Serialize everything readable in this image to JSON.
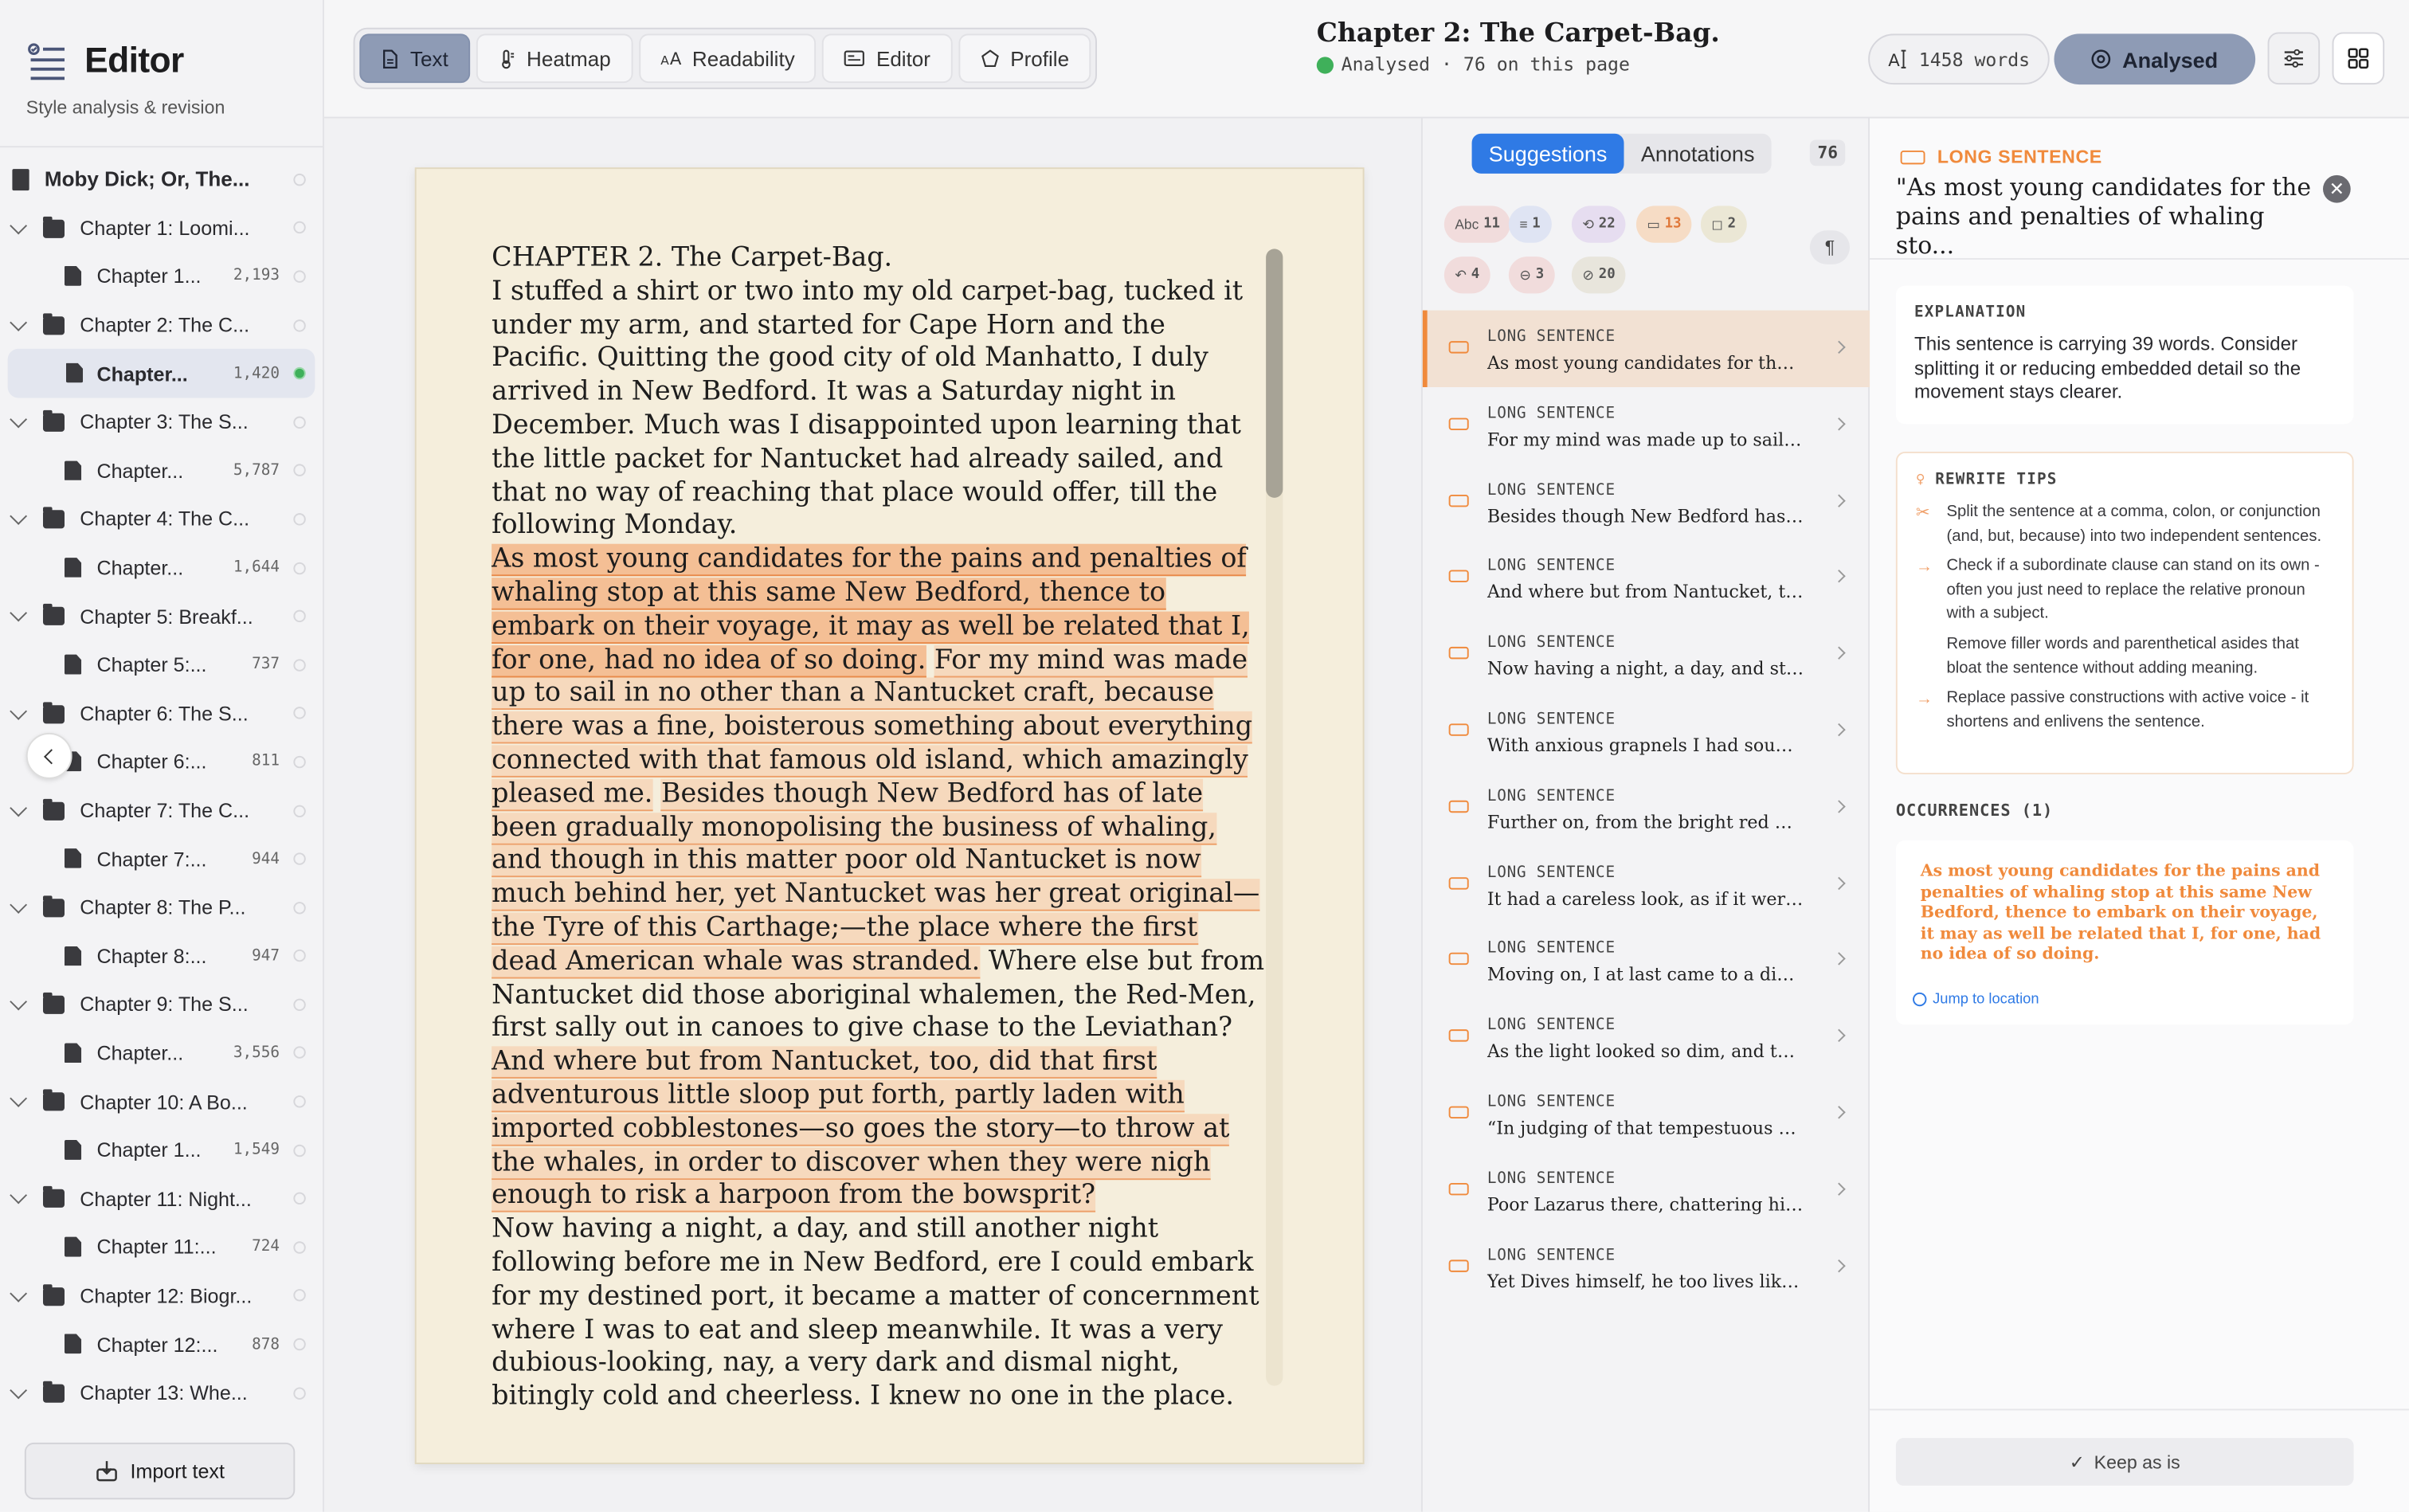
{
  "brand": {
    "title": "Editor",
    "subtitle": "Style analysis & revision"
  },
  "tree": [
    {
      "type": "root",
      "label": "Moby Dick; Or, The..."
    },
    {
      "type": "folder",
      "label": "Chapter 1: Loomi..."
    },
    {
      "type": "doc",
      "label": "Chapter 1...",
      "count": "2,193"
    },
    {
      "type": "folder",
      "label": "Chapter 2: The C..."
    },
    {
      "type": "doc",
      "label": "Chapter...",
      "count": "1,420",
      "selected": true
    },
    {
      "type": "folder",
      "label": "Chapter 3: The S..."
    },
    {
      "type": "doc",
      "label": "Chapter...",
      "count": "5,787"
    },
    {
      "type": "folder",
      "label": "Chapter 4: The C..."
    },
    {
      "type": "doc",
      "label": "Chapter...",
      "count": "1,644"
    },
    {
      "type": "folder",
      "label": "Chapter 5: Breakf..."
    },
    {
      "type": "doc",
      "label": "Chapter 5:...",
      "count": "737"
    },
    {
      "type": "folder",
      "label": "Chapter 6: The S..."
    },
    {
      "type": "doc",
      "label": "Chapter 6:...",
      "count": "811"
    },
    {
      "type": "folder",
      "label": "Chapter 7: The C..."
    },
    {
      "type": "doc",
      "label": "Chapter 7:...",
      "count": "944"
    },
    {
      "type": "folder",
      "label": "Chapter 8: The P..."
    },
    {
      "type": "doc",
      "label": "Chapter 8:...",
      "count": "947"
    },
    {
      "type": "folder",
      "label": "Chapter 9: The S..."
    },
    {
      "type": "doc",
      "label": "Chapter...",
      "count": "3,556"
    },
    {
      "type": "folder",
      "label": "Chapter 10: A Bo..."
    },
    {
      "type": "doc",
      "label": "Chapter 1...",
      "count": "1,549"
    },
    {
      "type": "folder",
      "label": "Chapter 11: Night..."
    },
    {
      "type": "doc",
      "label": "Chapter 11:...",
      "count": "724"
    },
    {
      "type": "folder",
      "label": "Chapter 12: Biogr..."
    },
    {
      "type": "doc",
      "label": "Chapter 12:...",
      "count": "878"
    },
    {
      "type": "folder",
      "label": "Chapter 13: Whe..."
    }
  ],
  "import_label": "Import text",
  "modes": [
    "Text",
    "Heatmap",
    "Readability",
    "Editor",
    "Profile"
  ],
  "active_mode": "Text",
  "doc": {
    "title": "Chapter 2: The Carpet-Bag.",
    "status": "Analysed · 76 on this page"
  },
  "words": "1458 words",
  "analysed_label": "Analysed",
  "page_text": {
    "heading": "CHAPTER 2. The Carpet-Bag.",
    "p1": "I stuffed a shirt or two into my old carpet-bag, tucked it under my arm, and started for Cape Horn and the Pacific. Quitting the good city of old Manhatto, I duly arrived in New Bedford. It was a Saturday night in December. Much was I disappointed upon learning that the little packet for Nantucket had already sailed, and that no way of reaching that place would offer, till the following Monday.",
    "s1": "As most young candidates for the pains and penalties of whaling stop at this same New Bedford, thence to embark on their voyage, it may as well be related that I, for one, had no idea of so doing.",
    "s2": "For my mind was made up to sail in no other than a Nantucket craft, because there was a fine, boisterous something about everything connected with that famous old island, which amazingly pleased me.",
    "s3": "Besides though New Bedford has of late been gradually monopolising the business of whaling, and though in this matter poor old Nantucket is now much behind her, yet Nantucket was her great original—the Tyre of this Carthage;—the place where the first dead American whale was stranded.",
    "plain1": "Where else but from Nantucket did those aboriginal whalemen, the Red-Men, first sally out in canoes to give chase to the Leviathan?",
    "s4": "And where but from Nantucket, too, did that first adventurous little sloop put forth, partly laden with imported cobblestones—so goes the story—to throw at the whales, in order to discover when they were nigh enough to risk a harpoon from the bowsprit?",
    "p3": "Now having a night, a day, and still another night following before me in New Bedford, ere I could embark for my destined port, it became a matter of concernment where I was to eat and sleep meanwhile. It was a very dubious-looking, nay, a very dark and dismal night, bitingly cold and cheerless. I knew no one in the place."
  },
  "sugg_tabs": [
    "Suggestions",
    "Annotations"
  ],
  "sugg_count": "76",
  "chips": [
    {
      "icon": "Abc",
      "n": "11",
      "bg": "#f1dcdc"
    },
    {
      "icon": "≡",
      "n": "1",
      "bg": "#dfe4f3"
    },
    {
      "icon": "⟲",
      "n": "22",
      "bg": "#e6ddf0"
    },
    {
      "icon": "▭",
      "n": "13",
      "bg": "#f6dcc5"
    },
    {
      "icon": "◻",
      "n": "2",
      "bg": "#ebe7d5"
    },
    {
      "icon": "↶",
      "n": "4",
      "bg": "#f1dcdc"
    },
    {
      "icon": "⊖",
      "n": "3",
      "bg": "#f1dcdc"
    },
    {
      "icon": "⊘",
      "n": "20",
      "bg": "#e8e5dc"
    }
  ],
  "para_icon": "¶",
  "suggestions": [
    {
      "kind": "LONG SENTENCE",
      "text": "As most young candidates for the p..."
    },
    {
      "kind": "LONG SENTENCE",
      "text": "For my mind was made up to sail in..."
    },
    {
      "kind": "LONG SENTENCE",
      "text": "Besides though New Bedford has of..."
    },
    {
      "kind": "LONG SENTENCE",
      "text": "And where but from Nantucket, too,..."
    },
    {
      "kind": "LONG SENTENCE",
      "text": "Now having a night, a day, and still..."
    },
    {
      "kind": "LONG SENTENCE",
      "text": "With anxious grapnels I had sound..."
    },
    {
      "kind": "LONG SENTENCE",
      "text": "Further on, from the bright red win..."
    },
    {
      "kind": "LONG SENTENCE",
      "text": "It had a careless look, as if it were m..."
    },
    {
      "kind": "LONG SENTENCE",
      "text": "Moving on, I at last came to a dim s..."
    },
    {
      "kind": "LONG SENTENCE",
      "text": "As the light looked so dim, and the..."
    },
    {
      "kind": "LONG SENTENCE",
      "text": "“In judging of that tempestuous wi..."
    },
    {
      "kind": "LONG SENTENCE",
      "text": "Poor Lazarus there, chattering his t..."
    },
    {
      "kind": "LONG SENTENCE",
      "text": "Yet Dives himself, he too lives like a..."
    }
  ],
  "detail": {
    "kind": "LONG SENTENCE",
    "quote": "\"As most young candidates for the pains and penalties of whaling sto...",
    "explanation_h": "EXPLANATION",
    "explanation": "This sentence is carrying 39 words. Consider splitting it or reducing embedded detail so the movement stays clearer.",
    "tips_h": "REWRITE TIPS",
    "tips": [
      "Split the sentence at a comma, colon, or conjunction (and, but, because) into two independent sentences.",
      "Check if a subordinate clause can stand on its own - often you just need to replace the relative pronoun with a subject.",
      "Remove filler words and parenthetical asides that bloat the sentence without adding meaning.",
      "Replace passive constructions with active voice - it shortens and enlivens the sentence."
    ],
    "occ_h": "OCCURRENCES (1)",
    "occurrence": "As most young candidates for the pains and penalties of whaling stop at this same New Bedford, thence to embark on their voyage, it may as well be related that I, for one, had no idea of so doing.",
    "jump": "Jump to location",
    "keep": "Keep as is"
  }
}
